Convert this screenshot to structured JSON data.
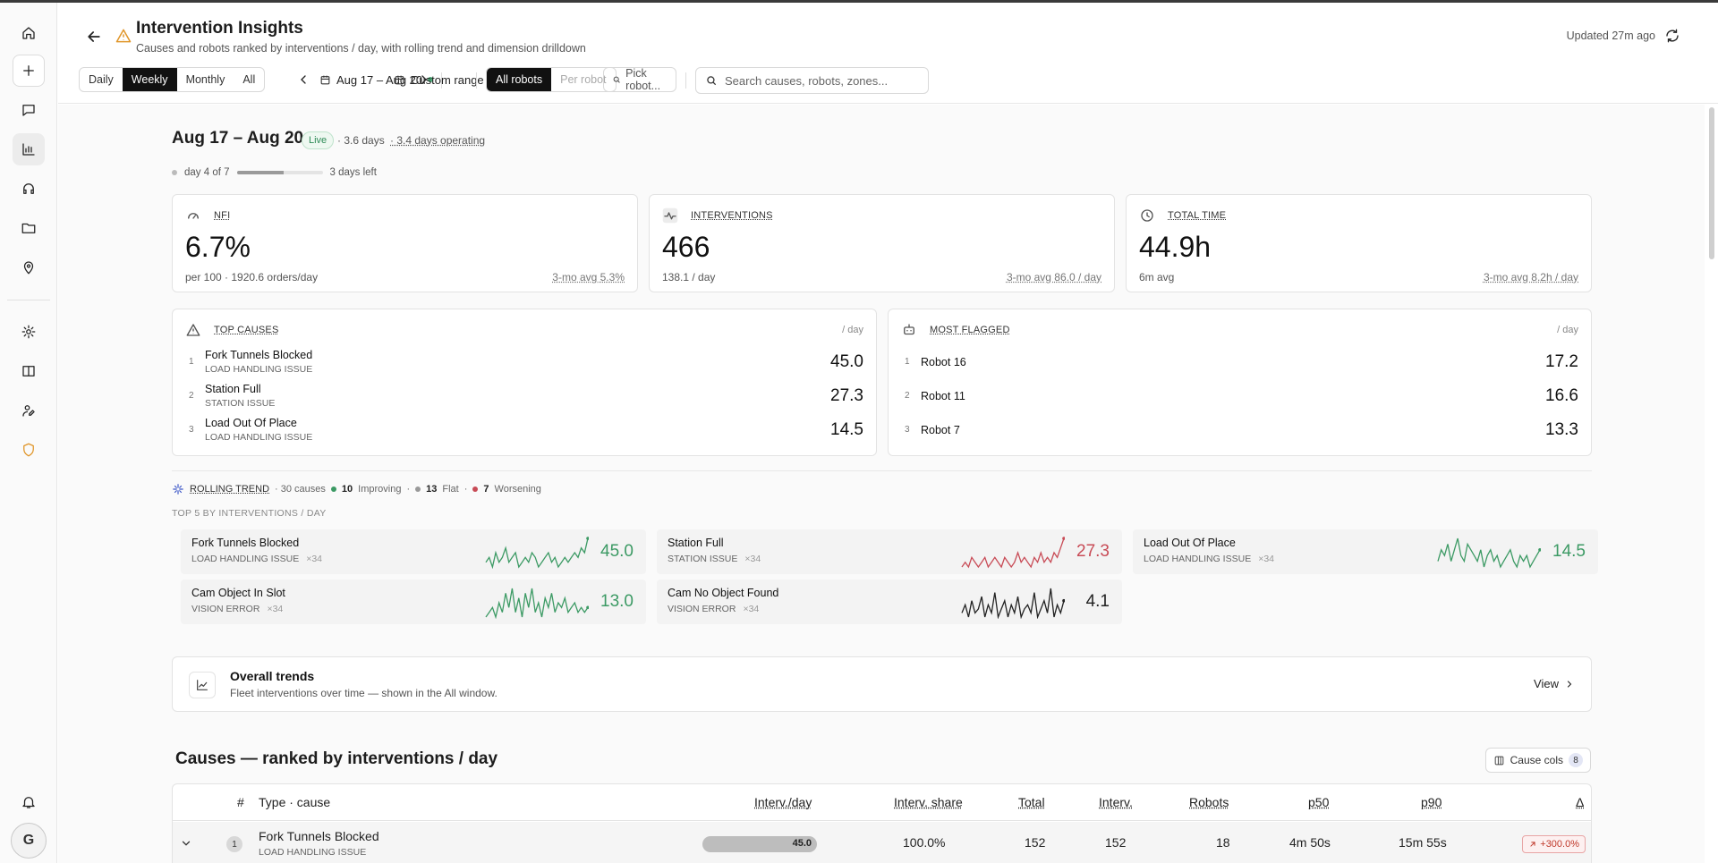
{
  "header": {
    "title": "Intervention Insights",
    "subtitle": "Causes and robots ranked by interventions / day, with rolling trend and dimension drilldown",
    "updated": "Updated 27m ago",
    "periods": [
      "Daily",
      "Weekly",
      "Monthly",
      "All"
    ],
    "active_period": "Weekly",
    "date_range": "Aug 17 – Aug 20",
    "custom_range": "Custom range",
    "robot_modes": [
      "All robots",
      "Per robot"
    ],
    "pick_robot": "Pick robot...",
    "search_placeholder": "Search causes, robots, zones..."
  },
  "summary": {
    "range": "Aug 17 – Aug 20",
    "live": "Live",
    "days": "· 3.6 days",
    "days_operating": "· 3.4 days operating",
    "progress_label": "day 4 of 7",
    "progress_fraction": 0.55,
    "days_left": "3 days left"
  },
  "stats": [
    {
      "label": "NFI",
      "value": "6.7%",
      "sub": "per 100 · 1920.6 orders/day",
      "avg": "3-mo avg 5.3%"
    },
    {
      "label": "INTERVENTIONS",
      "value": "466",
      "sub": "138.1 / day",
      "avg": "3-mo avg 86.0 / day"
    },
    {
      "label": "TOTAL TIME",
      "value": "44.9h",
      "sub": "6m avg",
      "avg": "3-mo avg 8.2h / day"
    }
  ],
  "top_causes": {
    "label": "TOP CAUSES",
    "unit": "/ day",
    "items": [
      {
        "rank": "1",
        "name": "Fork Tunnels Blocked",
        "type": "LOAD HANDLING ISSUE",
        "value": "45.0"
      },
      {
        "rank": "2",
        "name": "Station Full",
        "type": "STATION ISSUE",
        "value": "27.3"
      },
      {
        "rank": "3",
        "name": "Load Out Of Place",
        "type": "LOAD HANDLING ISSUE",
        "value": "14.5"
      }
    ]
  },
  "most_flagged": {
    "label": "MOST FLAGGED",
    "unit": "/ day",
    "items": [
      {
        "rank": "1",
        "name": "Robot 16",
        "value": "17.2"
      },
      {
        "rank": "2",
        "name": "Robot 11",
        "value": "16.6"
      },
      {
        "rank": "3",
        "name": "Robot 7",
        "value": "13.3"
      }
    ]
  },
  "trend": {
    "label": "ROLLING TREND",
    "causes": "· 30 causes",
    "improving_count": "10",
    "improving": "Improving",
    "flat_count": "13",
    "flat": "Flat",
    "worsening_count": "7",
    "worsening": "Worsening",
    "top5_label": "TOP 5 BY INTERVENTIONS / DAY",
    "colors": {
      "improving": "#3c9a64",
      "worsening": "#c84b56",
      "flat": "#222222"
    },
    "cards": [
      {
        "name": "Fork Tunnels Blocked",
        "type": "LOAD HANDLING ISSUE",
        "count": "×34",
        "value": "45.0",
        "status": "improving",
        "spark": [
          5,
          6,
          4,
          7,
          5,
          6,
          8,
          5,
          6,
          7,
          4,
          5,
          6,
          5,
          7,
          6,
          4,
          5,
          6,
          7,
          5,
          6,
          4,
          5,
          6,
          5,
          6,
          7,
          6,
          8,
          7,
          10
        ]
      },
      {
        "name": "Station Full",
        "type": "STATION ISSUE",
        "count": "×34",
        "value": "27.3",
        "status": "worsening",
        "spark": [
          4,
          5,
          4,
          6,
          5,
          4,
          5,
          6,
          4,
          5,
          6,
          5,
          4,
          6,
          5,
          4,
          5,
          7,
          5,
          6,
          5,
          4,
          6,
          5,
          7,
          5,
          6,
          5,
          7,
          6,
          8,
          10
        ]
      },
      {
        "name": "Load Out Of Place",
        "type": "LOAD HANDLING ISSUE",
        "count": "×34",
        "value": "14.5",
        "status": "improving",
        "spark": [
          5,
          7,
          6,
          8,
          5,
          7,
          9,
          6,
          5,
          8,
          7,
          6,
          5,
          7,
          4,
          6,
          7,
          5,
          6,
          4,
          5,
          6,
          7,
          5,
          4,
          6,
          5,
          6,
          4,
          5,
          6,
          7
        ]
      },
      {
        "name": "Cam Object In Slot",
        "type": "VISION ERROR",
        "count": "×34",
        "value": "13.0",
        "status": "improving",
        "spark": [
          3,
          4,
          5,
          3,
          6,
          4,
          8,
          5,
          9,
          4,
          7,
          3,
          8,
          5,
          9,
          4,
          6,
          3,
          7,
          5,
          8,
          4,
          6,
          5,
          7,
          4,
          5,
          6,
          4,
          5,
          4,
          5
        ]
      },
      {
        "name": "Cam No Object Found",
        "type": "VISION ERROR",
        "count": "×34",
        "value": "4.1",
        "status": "flat",
        "spark": [
          4,
          6,
          3,
          7,
          4,
          5,
          8,
          3,
          6,
          4,
          9,
          3,
          5,
          7,
          3,
          6,
          4,
          8,
          3,
          5,
          6,
          4,
          9,
          3,
          5,
          7,
          4,
          10,
          3,
          6,
          4,
          7
        ]
      }
    ]
  },
  "overall": {
    "title": "Overall trends",
    "sub": "Fleet interventions over time — shown in the All window.",
    "view": "View"
  },
  "causes": {
    "title": "Causes — ranked by interventions / day",
    "cols_label": "Cause cols",
    "cols_count": "8",
    "headers": {
      "rank": "#",
      "type_cause": "Type · cause",
      "interv_day": "Interv./day",
      "share": "Interv. share",
      "total": "Total",
      "interv": "Interv.",
      "robots": "Robots",
      "p50": "p50",
      "p90": "p90",
      "delta": "Δ"
    },
    "rows": [
      {
        "rank": "1",
        "name": "Fork Tunnels Blocked",
        "type": "LOAD HANDLING ISSUE",
        "interv_day": "45.0",
        "interv_day_fraction": 1.0,
        "share": "100.0%",
        "total": "152",
        "interv": "152",
        "robots": "18",
        "p50": "4m 50s",
        "p90": "15m 55s",
        "delta": "+300.0%"
      }
    ]
  }
}
